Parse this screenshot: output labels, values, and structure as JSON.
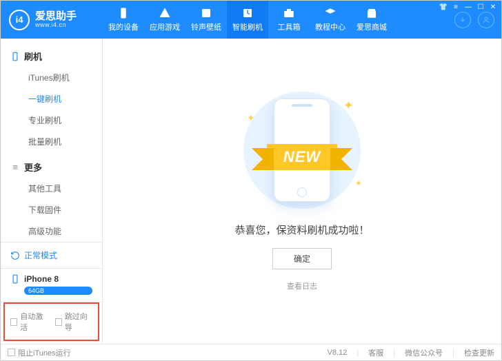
{
  "logo": {
    "badge": "i4",
    "title": "爱思助手",
    "sub": "www.i4.cn"
  },
  "nav": [
    {
      "id": "device",
      "label": "我的设备"
    },
    {
      "id": "apps",
      "label": "应用游戏"
    },
    {
      "id": "ringtone",
      "label": "铃声壁纸"
    },
    {
      "id": "flash",
      "label": "智能刷机"
    },
    {
      "id": "toolbox",
      "label": "工具箱"
    },
    {
      "id": "tutorial",
      "label": "教程中心"
    },
    {
      "id": "store",
      "label": "爱思商城"
    }
  ],
  "sidebar": {
    "group1": {
      "title": "刷机",
      "items": [
        {
          "id": "itunes-flash",
          "label": "iTunes刷机"
        },
        {
          "id": "oneclick-flash",
          "label": "一键刷机"
        },
        {
          "id": "pro-flash",
          "label": "专业刷机"
        },
        {
          "id": "batch-flash",
          "label": "批量刷机"
        }
      ]
    },
    "group2": {
      "title": "更多",
      "items": [
        {
          "id": "other-tools",
          "label": "其他工具"
        },
        {
          "id": "download-fw",
          "label": "下载固件"
        },
        {
          "id": "advanced",
          "label": "高级功能"
        }
      ]
    },
    "status": "正常模式",
    "device": {
      "name": "iPhone 8",
      "storage": "64GB"
    },
    "checks": {
      "auto_activate": "自动激活",
      "skip_guide": "跳过向导"
    }
  },
  "main": {
    "ribbon": "NEW",
    "message": "恭喜您，保资料刷机成功啦！",
    "ok": "确定",
    "log": "查看日志"
  },
  "footer": {
    "block_itunes": "阻止iTunes运行",
    "version": "V8.12",
    "support": "客服",
    "wechat": "微信公众号",
    "update": "检查更新"
  }
}
